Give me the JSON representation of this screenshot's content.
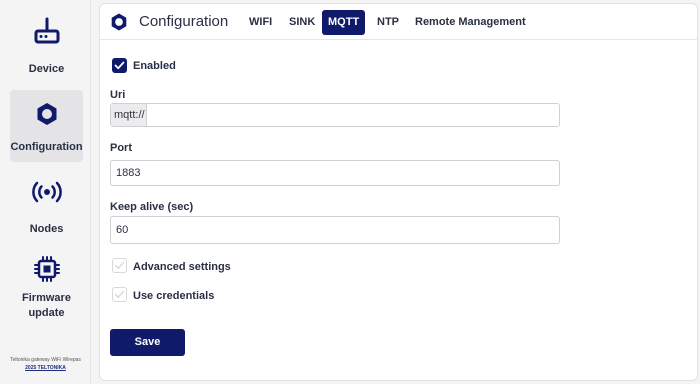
{
  "sidebar": {
    "items": [
      {
        "label": "Device",
        "icon": "router-icon"
      },
      {
        "label": "Configuration",
        "icon": "gear-icon"
      },
      {
        "label": "Nodes",
        "icon": "broadcast-icon"
      },
      {
        "label": "Firmware\nupdate",
        "icon": "chip-icon"
      }
    ],
    "active_index": 1,
    "footer_text": "Teltonika gateway WiFi Wirepas",
    "footer_link": "2025 TELTONIKA"
  },
  "header": {
    "title": "Configuration",
    "menu_icon": "kebab-icon",
    "tabs": [
      {
        "label": "WIFI"
      },
      {
        "label": "SINK"
      },
      {
        "label": "MQTT"
      },
      {
        "label": "NTP"
      },
      {
        "label": "Remote Management"
      }
    ],
    "active_tab": "MQTT"
  },
  "form": {
    "enabled_label": "Enabled",
    "enabled_checked": true,
    "uri_label": "Uri",
    "uri_prefix": "mqtt://",
    "uri_value": "",
    "port_label": "Port",
    "port_value": "1883",
    "keepalive_label": "Keep alive (sec)",
    "keepalive_value": "60",
    "advanced_label": "Advanced settings",
    "advanced_checked": false,
    "credentials_label": "Use credentials",
    "credentials_checked": false,
    "save_label": "Save"
  },
  "colors": {
    "accent": "#101a6b",
    "text": "#2a2f45",
    "background": "#f4f4f5"
  }
}
